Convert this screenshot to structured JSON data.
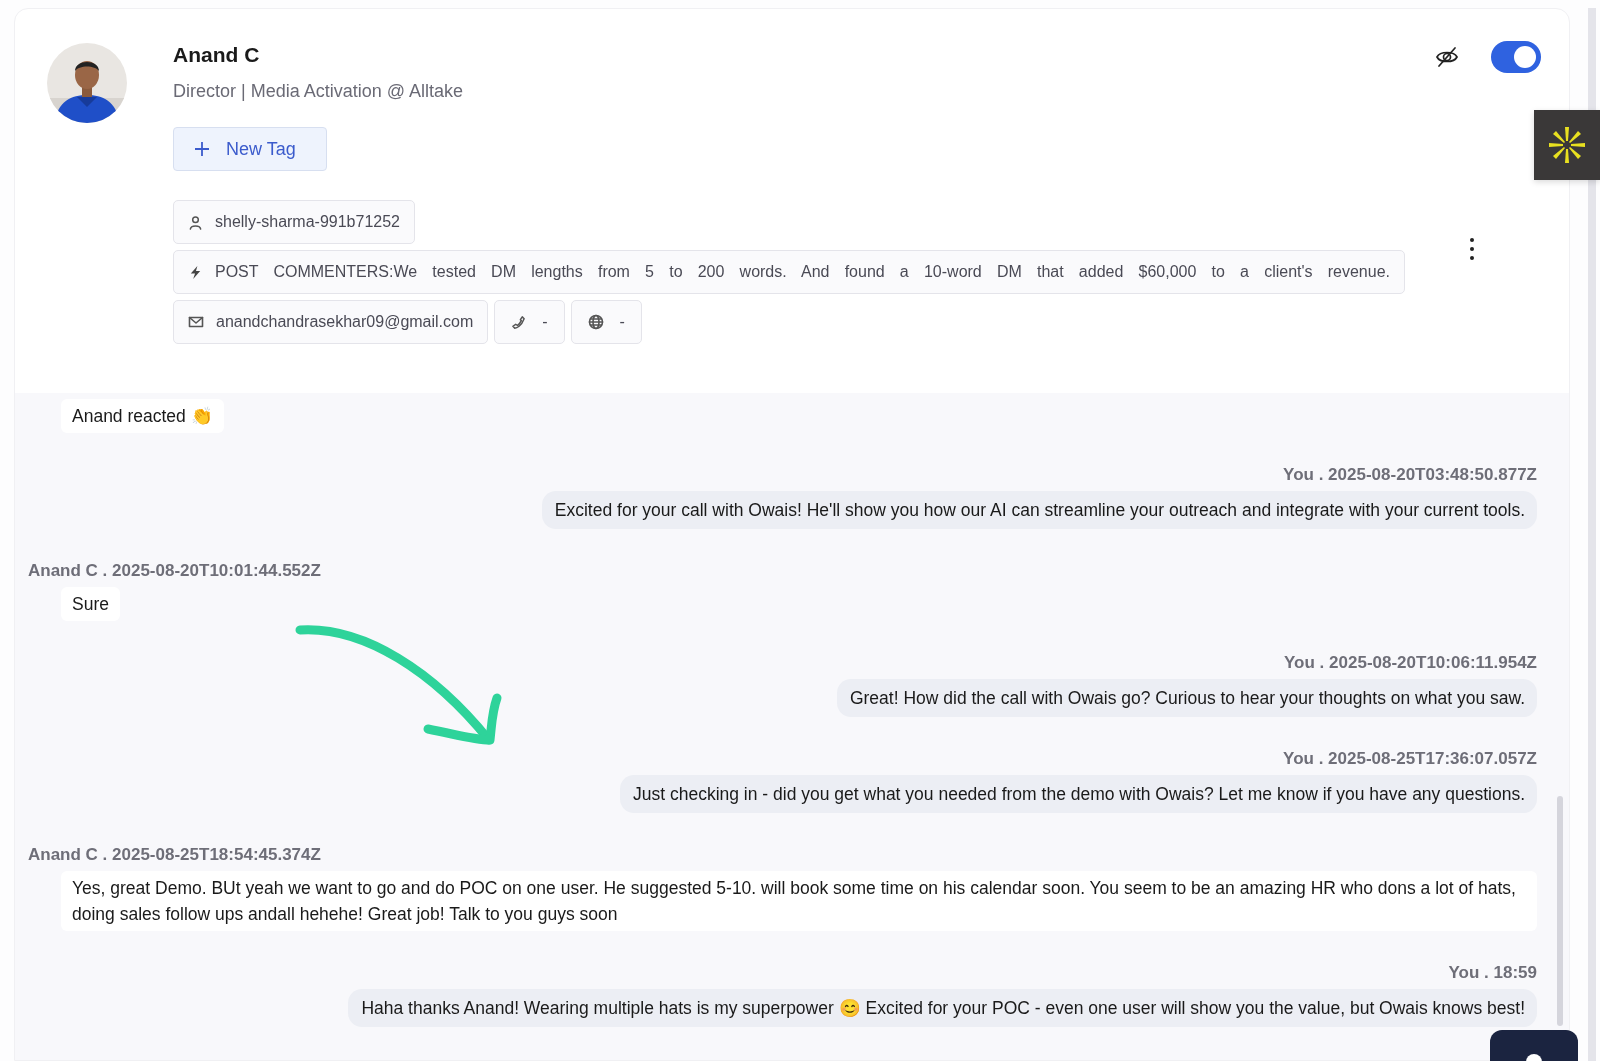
{
  "profile": {
    "name": "Anand C",
    "headline": "Director | Media Activation @ Alltake",
    "visibility_toggle": {
      "on": true
    }
  },
  "new_tag_button": {
    "label": "New Tag"
  },
  "details": [
    {
      "kind": "username",
      "text": "shelly-sharma-991b71252"
    },
    {
      "kind": "source",
      "text": "POST COMMENTERS:We tested DM lengths from 5 to 200 words. And found a 10-word DM that added $60,000 to a client's revenue."
    },
    {
      "kind": "email",
      "text": "anandchandrasekhar09@gmail.com"
    },
    {
      "kind": "phone",
      "text": "-"
    },
    {
      "kind": "website",
      "text": "-"
    }
  ],
  "messages": [
    {
      "kind": "reaction",
      "text": "Anand reacted 👏"
    },
    {
      "kind": "outgoing",
      "meta": "You . 2025-08-20T03:48:50.877Z",
      "text": "Excited for your call with Owais! He'll show you how our AI can streamline your outreach and integrate with your current tools."
    },
    {
      "kind": "incoming",
      "meta": "Anand C . 2025-08-20T10:01:44.552Z",
      "text": "Sure"
    },
    {
      "kind": "outgoing",
      "meta": "You . 2025-08-20T10:06:11.954Z",
      "text": "Great! How did the call with Owais go? Curious to hear your thoughts on what you saw."
    },
    {
      "kind": "outgoing",
      "meta": "You . 2025-08-25T17:36:07.057Z",
      "text": "Just checking in - did you get what you needed from the demo with Owais? Let me know if you have any questions."
    },
    {
      "kind": "incoming",
      "meta": "Anand C . 2025-08-25T18:54:45.374Z",
      "text": "Yes, great Demo. BUt yeah we want to go and do POC on one user. He suggested 5-10. will book some time on his calendar soon. You seem to be an amazing HR who dons a lot of hats, doing sales follow ups andall hehehe! Great job! Talk to you guys soon"
    },
    {
      "kind": "outgoing",
      "meta": "You . 18:59",
      "text": "Haha thanks Anand! Wearing multiple hats is my superpower 😊 Excited for your POC - even one user will show you the value, but Owais knows best!"
    }
  ]
}
